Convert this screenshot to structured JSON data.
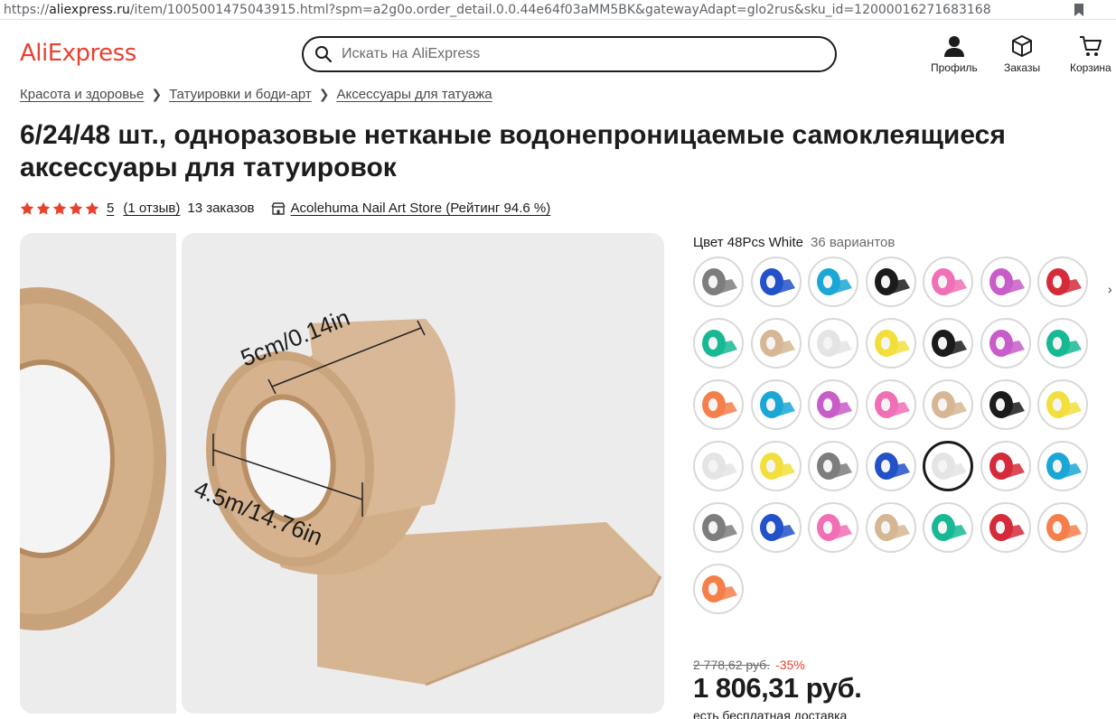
{
  "browser": {
    "url_prefix": "https://",
    "url_host": "aliexpress.ru",
    "url_rest": "/item/1005001475043915.html?spm=a2g0o.order_detail.0.0.44e64f03aMM5BK&gatewayAdapt=glo2rus&sku_id=12000016271683168"
  },
  "header": {
    "logo": "AliExpress",
    "search_placeholder": "Искать на AliExpress",
    "profile_label": "Профиль",
    "orders_label": "Заказы",
    "cart_label": "Корзина"
  },
  "breadcrumb": [
    "Красота и здоровье",
    "Татуировки и боди-арт",
    "Аксессуары для татуажа"
  ],
  "product": {
    "title": "6/24/48 шт., одноразовые нетканые водонепроницаемые самоклеящиеся аксессуары для татуировок",
    "rating_value": "5",
    "reviews": "(1 отзыв)",
    "orders": "13 заказов",
    "store": "Acolehuma Nail Art Store (Рейтинг 94.6 %)"
  },
  "image": {
    "width_label": "5cm/0.14in",
    "length_label": "4.5m/14.76in"
  },
  "variants": {
    "label": "Цвет 48Pcs White",
    "count": "36 вариантов",
    "swatch_colors": [
      "#7d7d7d",
      "#2251c9",
      "#1aa7d6",
      "#1b1b1b",
      "#f06fb5",
      "#c85cc8",
      "#d42a3a",
      "#17b894",
      "#d7b693",
      "#e4e4e4",
      "#f2df3c",
      "#1b1b1b",
      "#c85cc8",
      "#17b894",
      "#f57f4a",
      "#1aa7d6",
      "#c85cc8",
      "#f06fb5",
      "#d7b693",
      "#1b1b1b",
      "#f2df3c",
      "#e4e4e4",
      "#f2df3c",
      "#7d7d7d",
      "#2251c9",
      "#e4e4e4",
      "#d42a3a",
      "#1aa7d6",
      "#7d7d7d",
      "#2251c9",
      "#f06fb5",
      "#d7b693",
      "#17b894",
      "#d42a3a",
      "#f57f4a",
      "#f57f4a"
    ],
    "selected_index": 25
  },
  "price": {
    "old": "2 778,62 руб.",
    "discount": "-35%",
    "current": "1 806,31 руб.",
    "delivery": "есть бесплатная доставка"
  }
}
